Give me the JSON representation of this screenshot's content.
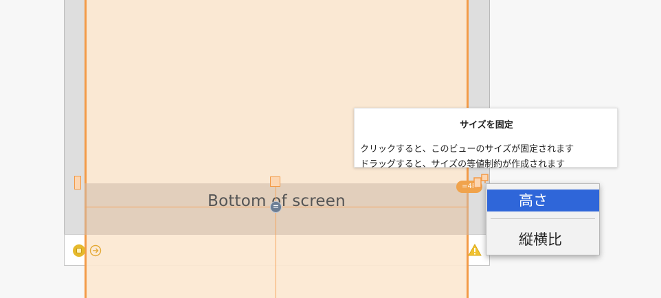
{
  "canvas": {
    "bottom_view_label": "Bottom of screen",
    "center_constraint_symbol": "=",
    "pin_badge_text": "=4R",
    "accent_color": "#f39a46"
  },
  "scene_bar": {
    "icons": [
      "view-controller-icon",
      "exit-icon",
      "warning-icon"
    ]
  },
  "tooltip": {
    "title": "サイズを固定",
    "line1": "クリックすると、このビューのサイズが固定されます",
    "line2": "ドラッグすると、サイズの等値制約が作成されます"
  },
  "menu": {
    "items": [
      {
        "label": "高さ",
        "selected": true
      },
      {
        "label": "縦横比",
        "selected": false
      }
    ],
    "highlight_color": "#2f66d9"
  }
}
